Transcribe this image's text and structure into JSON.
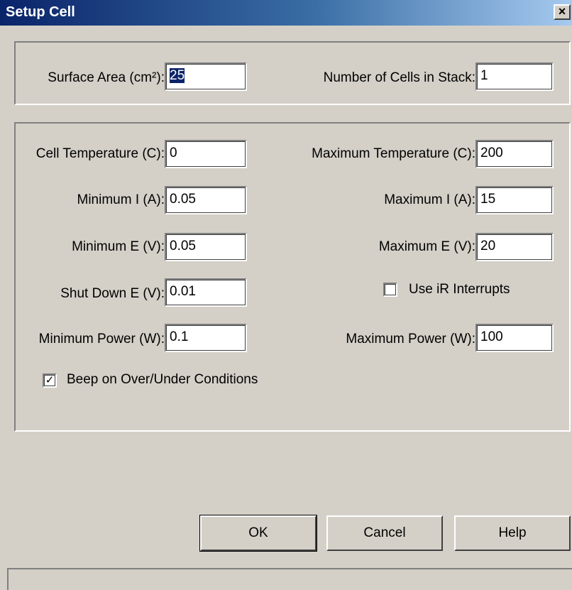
{
  "window": {
    "title": "Setup Cell",
    "close_glyph": "×"
  },
  "stack": {
    "surface_area": {
      "label": "Surface Area (cm²):",
      "value": "25"
    },
    "num_cells": {
      "label": "Number of Cells in Stack:",
      "value": "1"
    }
  },
  "limits": {
    "cell_temp": {
      "label": "Cell Temperature (C):",
      "value": "0"
    },
    "max_temp": {
      "label": "Maximum Temperature (C):",
      "value": "200"
    },
    "min_i": {
      "label": "Minimum I (A):",
      "value": "0.05"
    },
    "max_i": {
      "label": "Maximum I (A):",
      "value": "15"
    },
    "min_e": {
      "label": "Minimum E (V):",
      "value": "0.05"
    },
    "max_e": {
      "label": "Maximum E (V):",
      "value": "20"
    },
    "shutdown_e": {
      "label": "Shut Down E (V):",
      "value": "0.01"
    },
    "ir_interrupts": {
      "label": "Use iR Interrupts",
      "checked": false
    },
    "min_power": {
      "label": "Minimum Power (W):",
      "value": "0.1"
    },
    "max_power": {
      "label": "Maximum Power (W):",
      "value": "100"
    },
    "beep": {
      "label": "Beep on Over/Under Conditions",
      "checked": true,
      "mark": "✓"
    }
  },
  "buttons": {
    "ok": "OK",
    "cancel": "Cancel",
    "help": "Help"
  },
  "icons": {
    "close": "close-icon",
    "check": "check-icon"
  },
  "colors": {
    "title_start": "#0a246a",
    "title_end": "#a6caf0",
    "face": "#d4d0c8",
    "selection": "#0a246a"
  }
}
